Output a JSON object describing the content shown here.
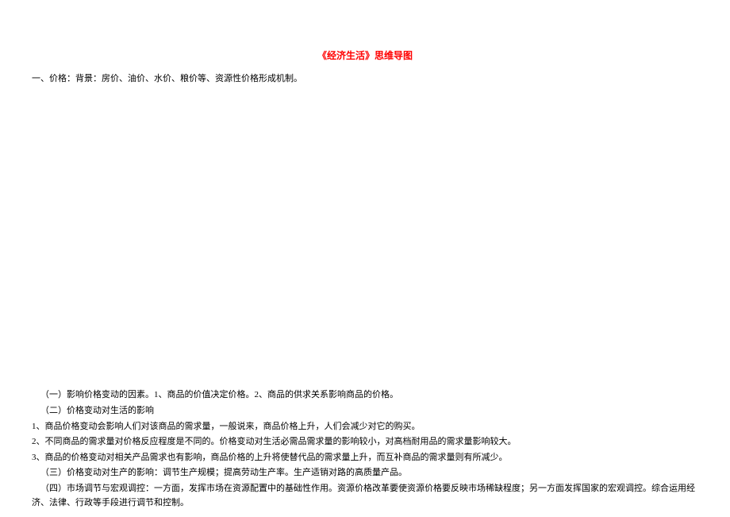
{
  "title": "《经济生活》思维导图",
  "sectionHeader": "一、价格：背景：房价、油价、水价、粮价等、资源性价格形成机制。",
  "content": {
    "line1": "（一）影响价格变动的因素。1、商品的价值决定价格。2、商品的供求关系影响商品的价格。",
    "line2": "（二）价格变动对生活的影响",
    "line3": "1、商品价格变动会影响人们对该商品的需求量，一般说来，商品价格上升，人们会减少对它的购买。",
    "line4": "2、不同商品的需求量对价格反应程度是不同的。价格变动对生活必需品需求量的影响较小，对高档耐用品的需求量影响较大。",
    "line5": "3、商品的价格变动对相关产品需求也有影响，商品价格的上升将使替代品的需求量上升，而互补商品的需求量则有所减少。",
    "line6": "（三）价格变动对生产的影响：调节生产规模；提高劳动生产率。生产适销对路的高质量产品。",
    "line7": "（四）市场调节与宏观调控：一方面，发挥市场在资源配置中的基础性作用。资源价格改革要使资源价格要反映市场稀缺程度；另一方面发挥国家的宏观调控。综合运用经济、法律、行政等手段进行调节和控制。"
  }
}
